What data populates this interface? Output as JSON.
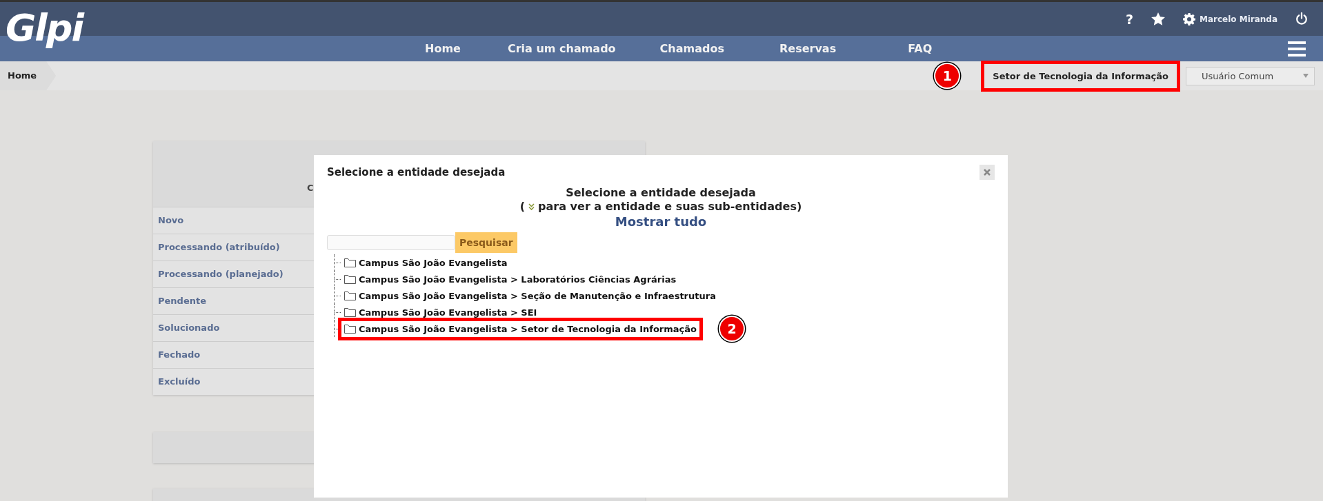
{
  "header": {
    "logo": "Glpi",
    "user": "Marcelo Miranda",
    "help": "?"
  },
  "nav": {
    "items": [
      {
        "label": "Home"
      },
      {
        "label": "Cria um chamado"
      },
      {
        "label": "Chamados"
      },
      {
        "label": "Reservas"
      },
      {
        "label": "FAQ"
      }
    ]
  },
  "breadcrumb": {
    "items": [
      "Home"
    ]
  },
  "entity": {
    "label": "Setor de Tecnologia da Informação",
    "highlight_badge": "1"
  },
  "profile": {
    "value": "Usuário Comum"
  },
  "status_panel": {
    "column_1": "C",
    "rows": [
      "Novo",
      "Processando (atribuído)",
      "Processando (planejado)",
      "Pendente",
      "Solucionado",
      "Fechado",
      "Excluído"
    ]
  },
  "modal": {
    "title": "Selecione a entidade desejada",
    "heading": "Selecione a entidade desejada",
    "hint_before": "(",
    "hint_after": "para ver a entidade e suas sub-entidades)",
    "show_all": "Mostrar tudo",
    "search_button": "Pesquisar",
    "tree": [
      {
        "label": "Campus São João Evangelista"
      },
      {
        "label": "Campus São João Evangelista > Laboratórios Ciências Agrárias"
      },
      {
        "label": "Campus São João Evangelista > Seção de Manutenção e Infraestrutura"
      },
      {
        "label": "Campus São João Evangelista > SEI"
      },
      {
        "label": "Campus São João Evangelista > Setor de Tecnologia da Informação",
        "highlight_badge": "2"
      }
    ]
  }
}
